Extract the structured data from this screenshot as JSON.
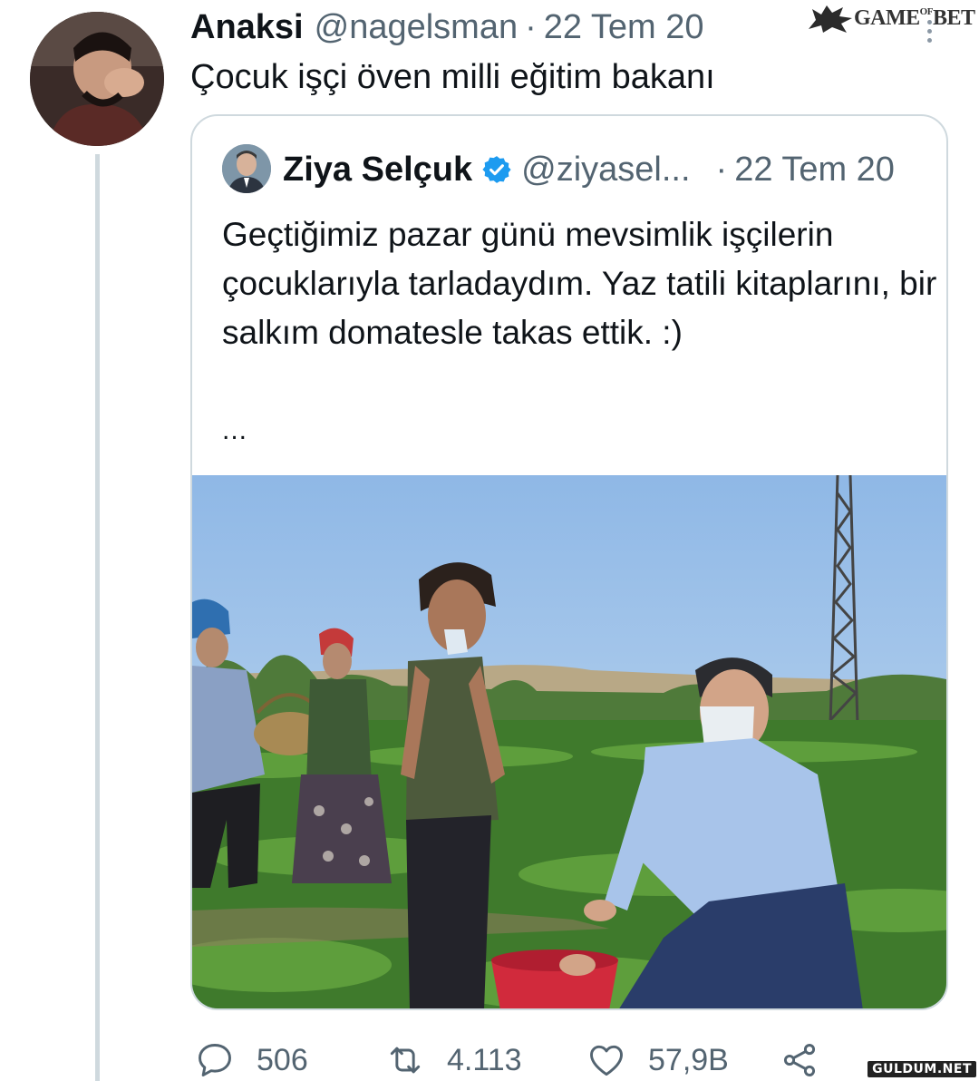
{
  "tweet": {
    "author_name": "Anaksi",
    "author_handle": "@nagelsman",
    "separator": "·",
    "date": "22 Tem 20",
    "text": "Çocuk işçi öven milli eğitim bakanı"
  },
  "quoted_tweet": {
    "author_name": "Ziya Selçuk",
    "verified": true,
    "author_handle": "@ziyasel...",
    "separator": "·",
    "date": "22 Tem 20",
    "text": "Geçtiğimiz pazar günü mevsimlik işçilerin çocuklarıyla tarladaydım. Yaz tatili kitaplarını, bir salkım domatesle takas ettik. :)",
    "ellipsis": "..."
  },
  "actions": {
    "reply_count": "506",
    "retweet_count": "4.113",
    "like_count": "57,9B"
  },
  "watermarks": {
    "top_right_logo": "GAME OF BET",
    "bottom_right": "GULDUM.NET"
  },
  "colors": {
    "text_primary": "#0f1419",
    "text_secondary": "#536471",
    "verified_blue": "#1d9bf0",
    "border": "#cfd9de"
  },
  "icons": {
    "more": "more-vertical-icon",
    "verified": "verified-badge-icon",
    "reply": "reply-bubble-icon",
    "retweet": "retweet-icon",
    "like": "heart-icon",
    "share": "share-icon"
  }
}
